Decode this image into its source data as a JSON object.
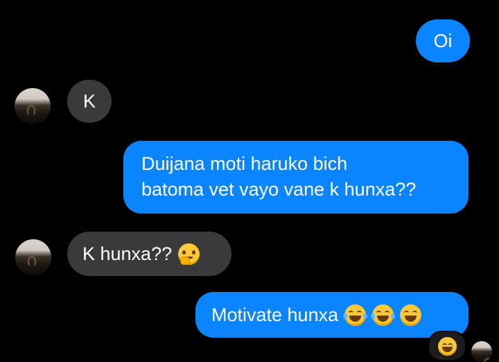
{
  "conversation": {
    "messages": [
      {
        "sender": "me",
        "text": "Oi"
      },
      {
        "sender": "them",
        "text": "K"
      },
      {
        "sender": "me",
        "line1": "Duijana moti haruko bich",
        "line2": "batoma vet vayo vane k hunxa??"
      },
      {
        "sender": "them",
        "text": "K hunxa??",
        "emoji": "thinking-face-icon"
      },
      {
        "sender": "me",
        "text": "Motivate hunxa",
        "emojis": [
          "tears-of-joy-icon",
          "tears-of-joy-icon",
          "grinning-squinting-face-icon"
        ]
      }
    ],
    "reaction_emoji": "grinning-squinting-face-icon"
  },
  "colors": {
    "background": "#000000",
    "outgoing_bubble": "#0a84ff",
    "incoming_bubble": "#3a3a3c",
    "text": "#ffffff"
  }
}
